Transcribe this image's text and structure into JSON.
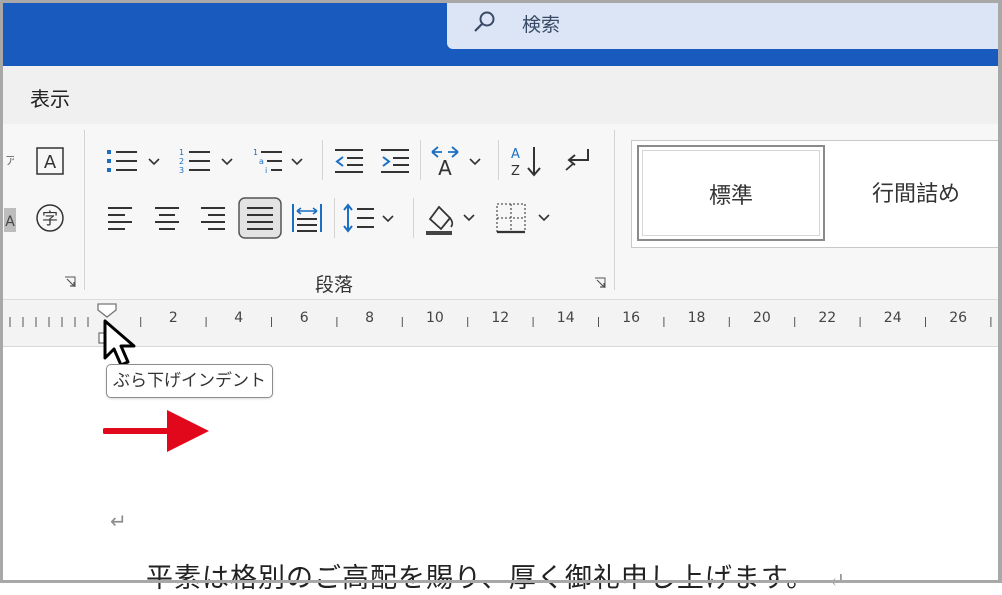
{
  "search": {
    "icon": "search-icon",
    "label": "検索"
  },
  "tabs": {
    "view": "表示"
  },
  "paragraph_group": {
    "label": "段落"
  },
  "styles": {
    "normal": "標準",
    "compact": "行間詰め"
  },
  "ruler": {
    "ticks": [
      "2",
      "4",
      "6",
      "8",
      "10",
      "12",
      "14",
      "16",
      "18",
      "20",
      "22",
      "24",
      "26"
    ]
  },
  "tooltip": {
    "text": "ぶら下げインデント"
  },
  "document": {
    "paragraph_mark": "↵",
    "body_text": "平素は格別のご高配を賜り、厚く御礼申し上げます。"
  },
  "colors": {
    "title_bar": "#185abd",
    "arrow": "#e0081a"
  }
}
